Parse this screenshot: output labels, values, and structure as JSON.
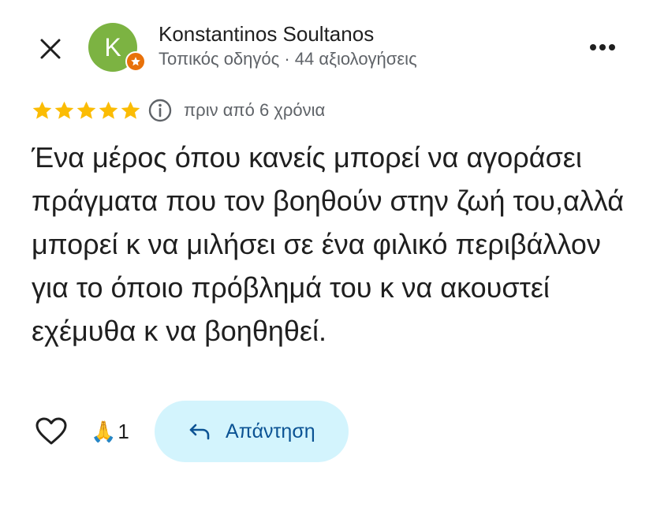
{
  "header": {
    "author_name": "Konstantinos Soultanos",
    "avatar_initial": "K",
    "author_meta": "Τοπικός οδηγός · 44 αξιολογήσεις",
    "close_icon": "close-icon",
    "more_icon": "more-horizontal-icon"
  },
  "review": {
    "rating": 5,
    "max_rating": 5,
    "time": "πριν από 6 χρόνια",
    "text": "Ένα μέρος όπου κανείς μπορεί να αγοράσει πράγματα που τον βοηθούν στην ζωή του,αλλά μπορεί κ να μιλήσει σε ένα φιλικό περιβάλλον για το όποιο πρόβλημά του κ να ακουστεί εχέμυθα κ να βοηθηθεί."
  },
  "actions": {
    "reaction_emoji": "🙏",
    "reaction_count": "1",
    "reply_label": "Απάντηση"
  },
  "colors": {
    "avatar": "#7cb342",
    "badge": "#e8710a",
    "star": "#fbbc04",
    "reply_bg": "#d3f4fd",
    "reply_text": "#0b5394",
    "muted": "#5f6368"
  }
}
